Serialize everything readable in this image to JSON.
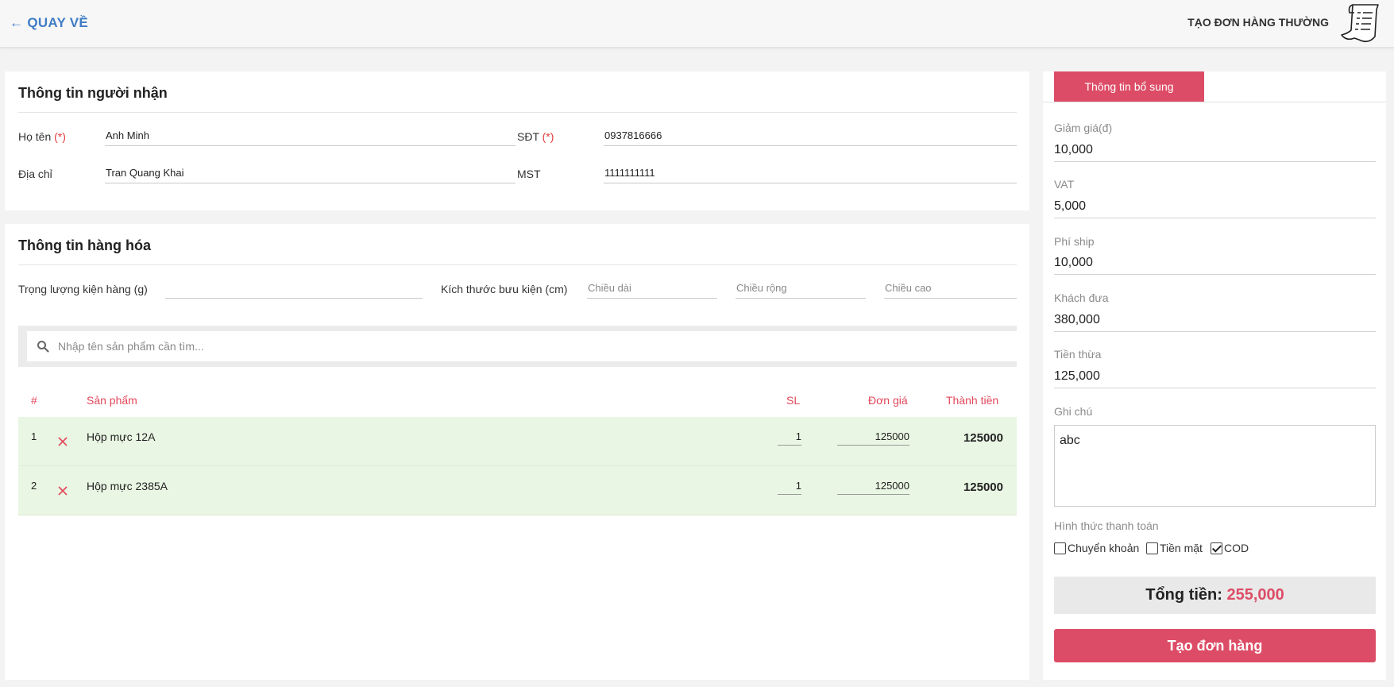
{
  "header": {
    "back_label": "← QUAY VỀ",
    "title": "TẠO ĐƠN HÀNG THƯỜNG",
    "icon": "receipt-icon"
  },
  "recipient": {
    "title": "Thông tin người nhận",
    "name_label": "Họ tên",
    "name_value": "Anh Minh",
    "phone_label": "SĐT",
    "phone_value": "0937816666",
    "required_mark": "(*)",
    "address_label": "Địa chỉ",
    "address_value": "Tran Quang Khai",
    "tax_label": "MST",
    "tax_value": "1111111111"
  },
  "goods": {
    "title": "Thông tin hàng hóa",
    "weight_label": "Trọng lượng kiện hàng (g)",
    "weight_value": "",
    "size_label": "Kích thước bưu kiện (cm)",
    "length_placeholder": "Chiều dài",
    "width_placeholder": "Chiều rộng",
    "height_placeholder": "Chiều cao",
    "search_placeholder": "Nhập tên sản phẩm cần tìm...",
    "columns": {
      "index": "#",
      "product": "Sản phẩm",
      "qty": "SL",
      "price": "Đơn giá",
      "total": "Thành tiền"
    },
    "items": [
      {
        "index": "1",
        "name": "Hộp mực 12A",
        "qty": "1",
        "price": "125000",
        "total": "125000"
      },
      {
        "index": "2",
        "name": "Hộp mực 2385A",
        "qty": "1",
        "price": "125000",
        "total": "125000"
      }
    ]
  },
  "sidebar": {
    "tab_label": "Thông tin bổ sung",
    "discount_label": "Giảm giá(đ)",
    "discount_value": "10,000",
    "vat_label": "VAT",
    "vat_value": "5,000",
    "ship_label": "Phí ship",
    "ship_value": "10,000",
    "paid_label": "Khách đưa",
    "paid_value": "380,000",
    "change_label": "Tiền thừa",
    "change_value": "125,000",
    "note_label": "Ghi chú",
    "note_value": "abc",
    "payment_label": "Hình thức thanh toán",
    "payment_options": [
      {
        "label": "Chuyển khoản",
        "checked": false
      },
      {
        "label": "Tiền mặt",
        "checked": false
      },
      {
        "label": "COD",
        "checked": true
      }
    ],
    "total_label": "Tổng tiền:",
    "total_value": "255,000",
    "submit_label": "Tạo đơn hàng"
  },
  "colors": {
    "accent": "#dd4c66",
    "link": "#3e7cc4",
    "row_bg": "#e9f6e3"
  }
}
